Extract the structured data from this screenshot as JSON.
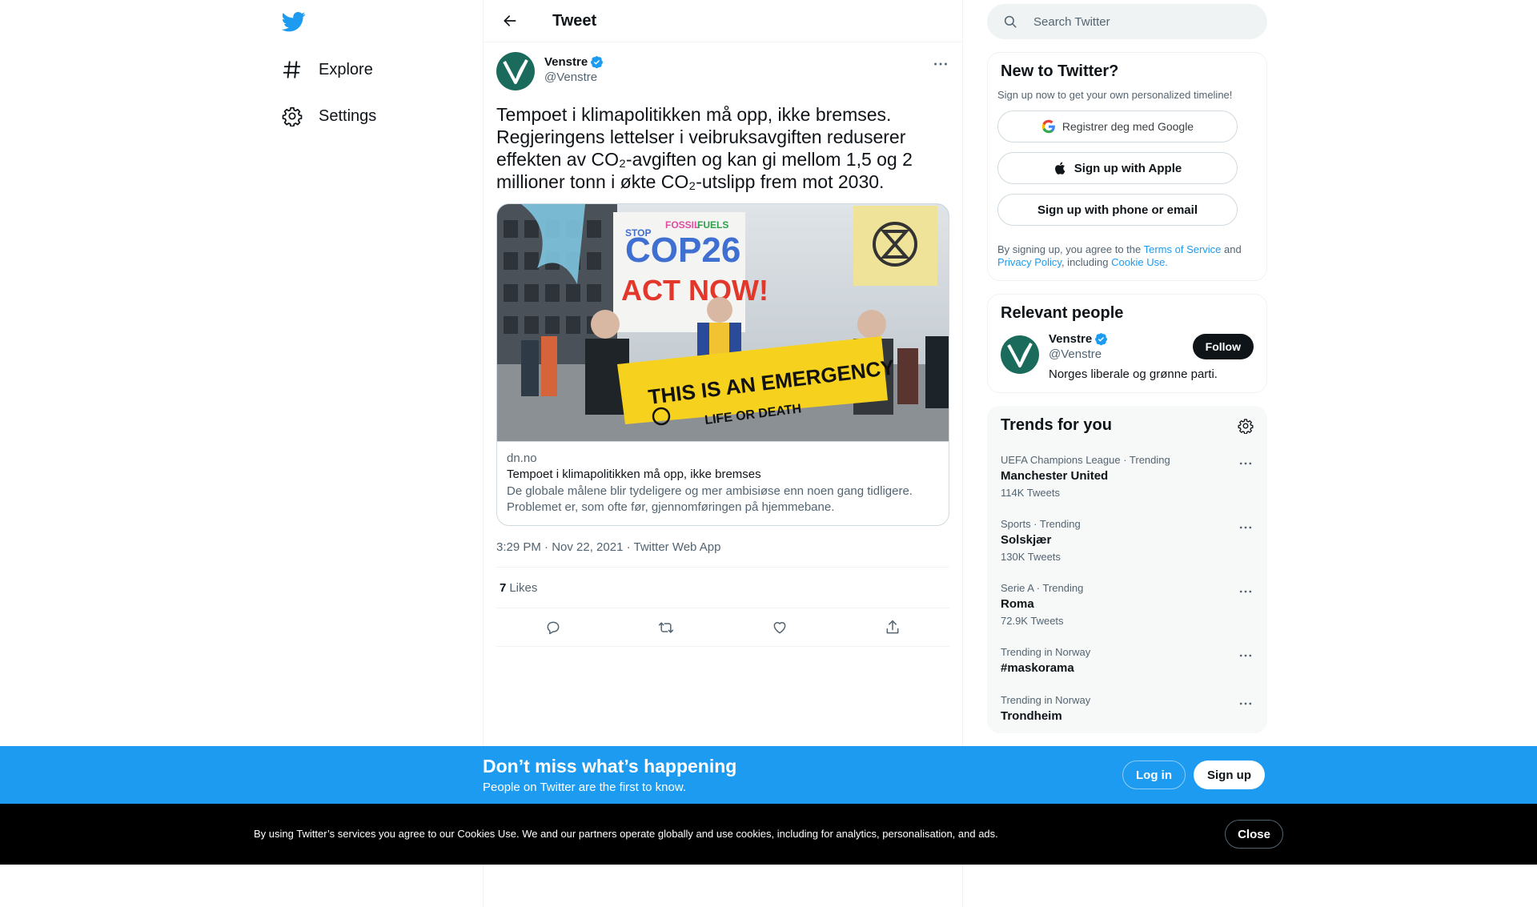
{
  "nav": {
    "items": [
      {
        "label": "Explore",
        "icon": "hashtag-icon"
      },
      {
        "label": "Settings",
        "icon": "gear-icon"
      }
    ]
  },
  "header": {
    "title": "Tweet"
  },
  "tweet": {
    "author": {
      "name": "Venstre",
      "handle": "@Venstre"
    },
    "text": "Tempoet i klimapolitikken må opp, ikke bremses. Regjeringens lettelser i veibruksavgiften reduserer effekten av CO₂-avgiften og kan gi mellom 1,5 og 2 millioner tonn i økte CO₂-utslipp frem mot 2030.",
    "card": {
      "domain": "dn.no",
      "title": "Tempoet i klimapolitikken må opp, ikke bremses",
      "description": "De globale målene blir tydeligere og mer ambisiøse enn noen gang tidligere. Problemet er, som ofte før, gjennomføringen på hjemmebane.",
      "image_text": {
        "banner_top_1": "COP26",
        "banner_top_2": "ACT NOW!",
        "banner_side_1": "STOP",
        "banner_side_2": "FOSSIL",
        "banner_side_3": "FUELS",
        "banner_bottom_1": "THIS IS AN EMERGENCY",
        "banner_bottom_2": "LIFE OR DEATH"
      }
    },
    "timestamp": "3:29 PM · Nov 22, 2021 · Twitter Web App",
    "likes_count": "7",
    "likes_label": "Likes"
  },
  "search": {
    "placeholder": "Search Twitter"
  },
  "new_to_twitter": {
    "title": "New to Twitter?",
    "subtitle": "Sign up now to get your own personalized timeline!",
    "google_label": "Registrer deg med Google",
    "apple_label": "Sign up with Apple",
    "phone_label": "Sign up with phone or email",
    "legal_prefix": "By signing up, you agree to the ",
    "terms_link": "Terms of Service",
    "legal_and": " and ",
    "privacy_link": "Privacy Policy",
    "legal_including": ", including ",
    "cookie_link": "Cookie Use."
  },
  "relevant_people": {
    "title": "Relevant people",
    "name": "Venstre",
    "handle": "@Venstre",
    "bio": "Norges liberale og grønne parti.",
    "follow_label": "Follow"
  },
  "trends": {
    "title": "Trends for you",
    "items": [
      {
        "meta": "UEFA Champions League · Trending",
        "name": "Manchester United",
        "count": "114K Tweets"
      },
      {
        "meta": "Sports · Trending",
        "name": "Solskjær",
        "count": "130K Tweets"
      },
      {
        "meta": "Serie A · Trending",
        "name": "Roma",
        "count": "72.9K Tweets"
      },
      {
        "meta": "Trending in Norway",
        "name": "#maskorama",
        "count": ""
      },
      {
        "meta": "Trending in Norway",
        "name": "Trondheim",
        "count": ""
      }
    ]
  },
  "bottom_bar": {
    "title": "Don’t miss what’s happening",
    "subtitle": "People on Twitter are the first to know.",
    "login_label": "Log in",
    "signup_label": "Sign up"
  },
  "cookie_bar": {
    "text": "By using Twitter’s services you agree to our Cookies Use. We and our partners operate globally and use cookies, including for analytics, personalisation, and ads.",
    "close_label": "Close"
  },
  "colors": {
    "accent": "#1d9bf0",
    "text_primary": "#0f1419",
    "text_secondary": "#536471",
    "venstre_green": "#1b6b5c"
  }
}
